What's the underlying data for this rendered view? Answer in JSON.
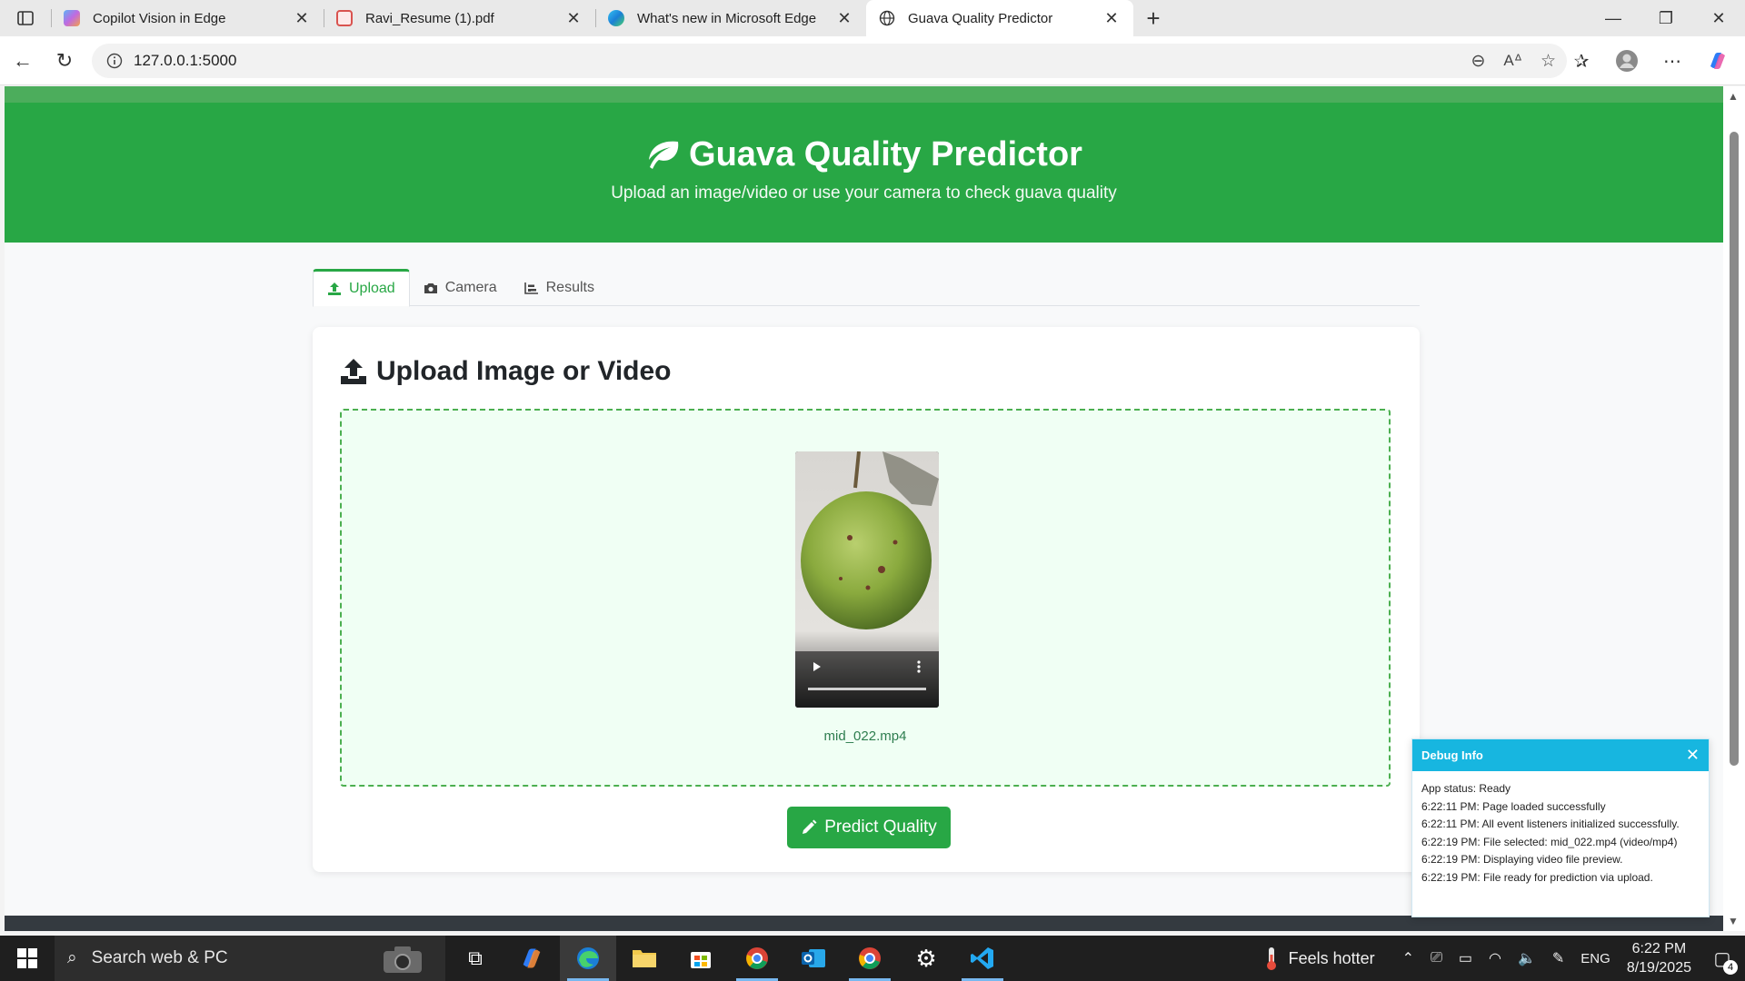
{
  "browser": {
    "tabs": [
      {
        "title": "Copilot Vision in Edge",
        "icon": "copilot-icon",
        "active": false
      },
      {
        "title": "Ravi_Resume (1).pdf",
        "icon": "pdf-icon",
        "active": false
      },
      {
        "title": "What's new in Microsoft Edge",
        "icon": "edge-icon",
        "active": false
      },
      {
        "title": "Guava Quality Predictor",
        "icon": "globe-icon",
        "active": true
      }
    ],
    "url": "127.0.0.1:5000"
  },
  "page": {
    "title": "Guava Quality Predictor",
    "subtitle": "Upload an image/video or use your camera to check guava quality",
    "tabs": [
      {
        "label": "Upload",
        "icon": "upload-icon",
        "active": true
      },
      {
        "label": "Camera",
        "icon": "camera-icon",
        "active": false
      },
      {
        "label": "Results",
        "icon": "chart-icon",
        "active": false
      }
    ],
    "upload_heading": "Upload Image or Video",
    "file_name": "mid_022.mp4",
    "predict_label": "Predict Quality",
    "accent_color": "#28a745"
  },
  "debug": {
    "title": "Debug Info",
    "lines": [
      "App status: Ready",
      "6:22:11 PM: Page loaded successfully",
      "6:22:11 PM: All event listeners initialized successfully.",
      "6:22:19 PM: File selected: mid_022.mp4 (video/mp4)",
      "6:22:19 PM: Displaying video file preview.",
      "6:22:19 PM: File ready for prediction via upload."
    ]
  },
  "taskbar": {
    "search_placeholder": "Search web & PC",
    "weather": "Feels hotter",
    "language": "ENG",
    "time": "6:22 PM",
    "date": "8/19/2025",
    "notification_count": "4"
  }
}
